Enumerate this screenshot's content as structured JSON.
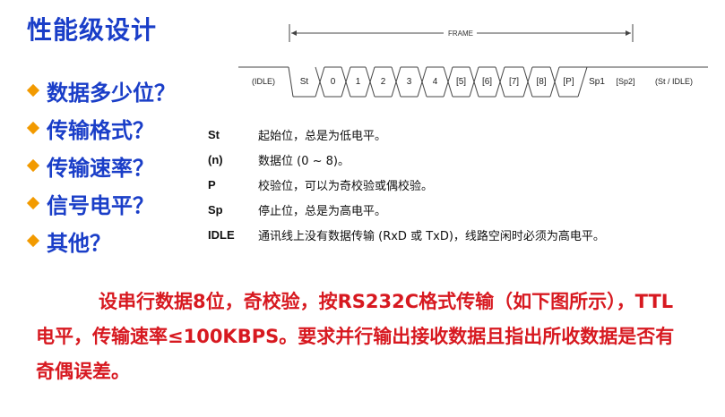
{
  "title": "性能级设计",
  "bullets": [
    "数据多少位？",
    "传输格式？",
    "传输速率？",
    "信号电平？",
    "其他？"
  ],
  "frame": {
    "label": "FRAME",
    "cells": [
      "(IDLE)",
      "St",
      "0",
      "1",
      "2",
      "3",
      "4",
      "[5]",
      "[6]",
      "[7]",
      "[8]",
      "[P]",
      "Sp1",
      "[Sp2]",
      "(St / IDLE)"
    ]
  },
  "legend": [
    {
      "key": "St",
      "desc": "起始位，总是为低电平。"
    },
    {
      "key": "(n)",
      "desc": "数据位 (0 ~ 8)。"
    },
    {
      "key": "P",
      "desc": "校验位，可以为奇校验或偶校验。"
    },
    {
      "key": "Sp",
      "desc": "停止位，总是为高电平。"
    },
    {
      "key": "IDLE",
      "desc": "通讯线上没有数据传输 (RxD 或 TxD)，线路空闲时必须为高电平。"
    }
  ],
  "task": "设串行数据8位，奇校验，按RS232C格式传输（如下图所示），TTL电平，传输速率≤100KBPS。要求并行输出接收数据且指出所收数据是否有奇偶误差。",
  "colors": {
    "title": "#1a3ec8",
    "bullet_marker": "#f29a00",
    "task": "#d71920"
  }
}
